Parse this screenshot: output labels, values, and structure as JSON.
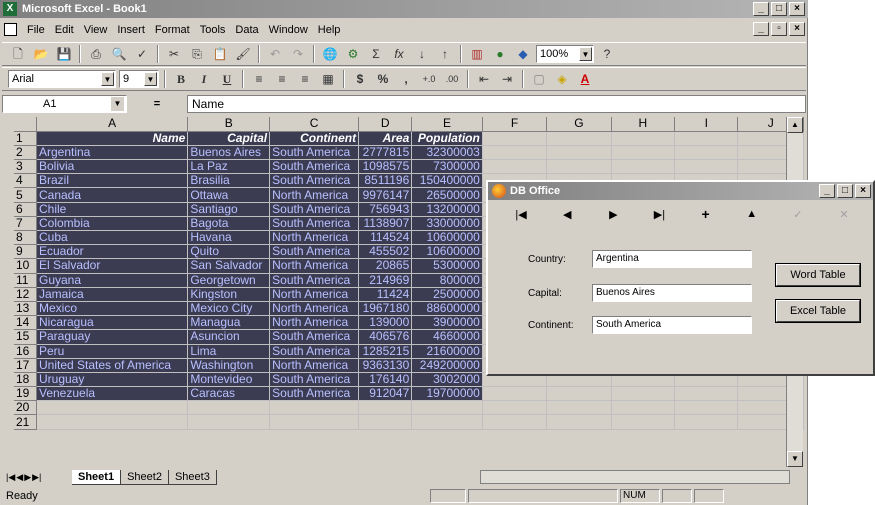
{
  "excel": {
    "title": "Microsoft Excel - Book1",
    "menu": [
      "File",
      "Edit",
      "View",
      "Insert",
      "Format",
      "Tools",
      "Data",
      "Window",
      "Help"
    ],
    "toolbar1": {
      "zoom": "100%"
    },
    "toolbar2": {
      "font": "Arial",
      "font_size": "9",
      "bold": "B",
      "italic": "I",
      "underline": "U",
      "currency": "$",
      "percent": "%",
      "comma": ","
    },
    "formula_bar": {
      "cell_ref": "A1",
      "equals": "=",
      "content": "Name"
    },
    "columns": [
      "A",
      "B",
      "C",
      "D",
      "E",
      "F",
      "G",
      "H",
      "I",
      "J"
    ],
    "header_row": [
      "Name",
      "Capital",
      "Continent",
      "Area",
      "Population"
    ],
    "rows": [
      [
        "Argentina",
        "Buenos Aires",
        "South America",
        "2777815",
        "32300003"
      ],
      [
        "Bolivia",
        "La Paz",
        "South America",
        "1098575",
        "7300000"
      ],
      [
        "Brazil",
        "Brasilia",
        "South America",
        "8511196",
        "150400000"
      ],
      [
        "Canada",
        "Ottawa",
        "North America",
        "9976147",
        "26500000"
      ],
      [
        "Chile",
        "Santiago",
        "South America",
        "756943",
        "13200000"
      ],
      [
        "Colombia",
        "Bagota",
        "South America",
        "1138907",
        "33000000"
      ],
      [
        "Cuba",
        "Havana",
        "North America",
        "114524",
        "10600000"
      ],
      [
        "Ecuador",
        "Quito",
        "South America",
        "455502",
        "10600000"
      ],
      [
        "El Salvador",
        "San Salvador",
        "North America",
        "20865",
        "5300000"
      ],
      [
        "Guyana",
        "Georgetown",
        "South America",
        "214969",
        "800000"
      ],
      [
        "Jamaica",
        "Kingston",
        "North America",
        "11424",
        "2500000"
      ],
      [
        "Mexico",
        "Mexico City",
        "North America",
        "1967180",
        "88600000"
      ],
      [
        "Nicaragua",
        "Managua",
        "North America",
        "139000",
        "3900000"
      ],
      [
        "Paraguay",
        "Asuncion",
        "South America",
        "406576",
        "4660000"
      ],
      [
        "Peru",
        "Lima",
        "South America",
        "1285215",
        "21600000"
      ],
      [
        "United States of America",
        "Washington",
        "North America",
        "9363130",
        "249200000"
      ],
      [
        "Uruguay",
        "Montevideo",
        "South America",
        "176140",
        "3002000"
      ],
      [
        "Venezuela",
        "Caracas",
        "South America",
        "912047",
        "19700000"
      ]
    ],
    "row_numbers": [
      "1",
      "2",
      "3",
      "4",
      "5",
      "6",
      "7",
      "8",
      "9",
      "10",
      "11",
      "12",
      "13",
      "14",
      "15",
      "16",
      "17",
      "18",
      "19",
      "20",
      "21"
    ],
    "sheets": [
      "Sheet1",
      "Sheet2",
      "Sheet3"
    ],
    "status": "Ready",
    "num_indicator": "NUM"
  },
  "dboffice": {
    "title": "DB Office",
    "fields": [
      {
        "label": "Country:",
        "value": "Argentina"
      },
      {
        "label": "Capital:",
        "value": "Buenos Aires"
      },
      {
        "label": "Continent:",
        "value": "South America"
      }
    ],
    "buttons": {
      "word_table": "Word Table",
      "excel_table": "Excel Table"
    }
  }
}
